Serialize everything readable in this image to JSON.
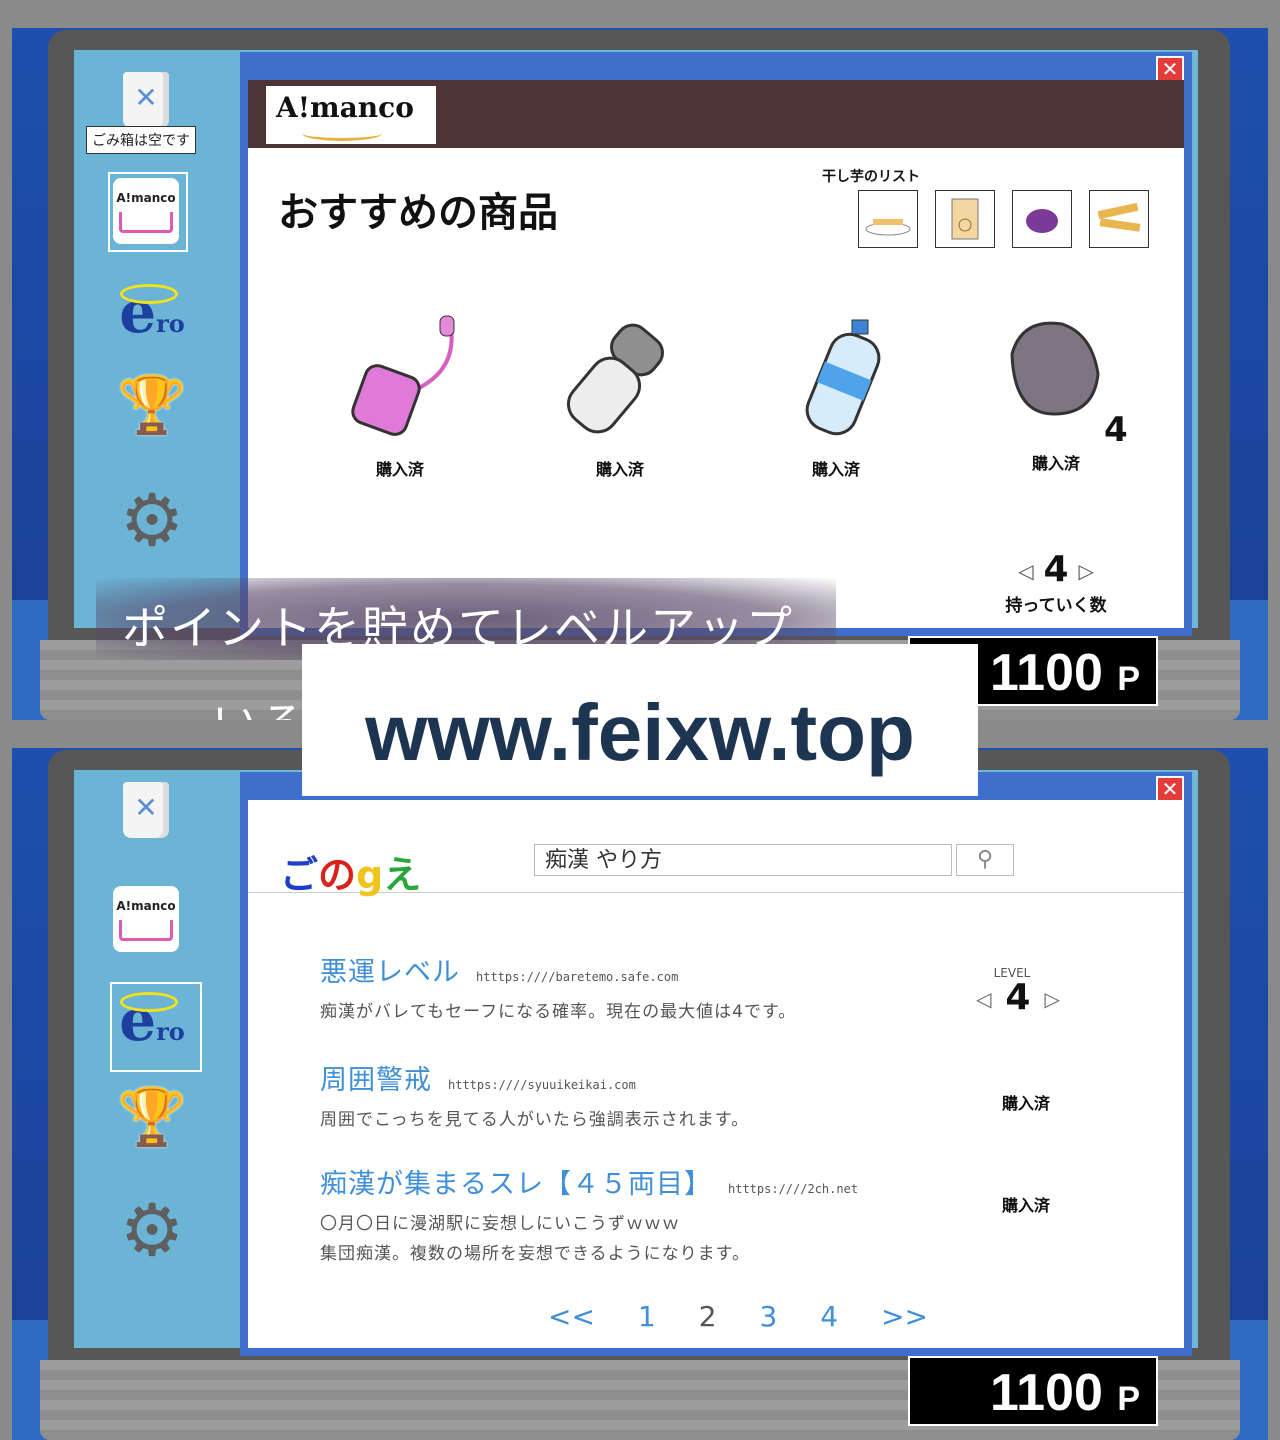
{
  "panel1": {
    "desktop": {
      "trash_tooltip": "ごみ箱は空です",
      "icons": [
        "trash-icon",
        "almanco-app-icon",
        "ero-browser-icon",
        "trophy-icon",
        "gear-icon"
      ],
      "almanco_icon_label": "A!manco",
      "ero_label_e": "e",
      "ero_label_ro": "ro"
    },
    "store": {
      "logo": "A!manco",
      "section_title": "おすすめの商品",
      "potato_list_title": "干し芋のリスト",
      "products": [
        {
          "name": "pink-vibrator",
          "status": "購入済"
        },
        {
          "name": "massager",
          "status": "購入済"
        },
        {
          "name": "water-bottle",
          "status": "購入済"
        },
        {
          "name": "stone",
          "status": "購入済",
          "count": "4"
        }
      ],
      "carry": {
        "value": "4",
        "prev": "◁",
        "next": "▷",
        "label": "持っていく数"
      }
    },
    "points": {
      "value": "1100",
      "unit": "P"
    },
    "caption_line1": "ポイントを貯めてレベルアップ",
    "caption_line2": "いろ",
    "watermark": "www.feixw.top",
    "close": "✕"
  },
  "panel2": {
    "desktop": {
      "almanco_icon_label": "A!manco",
      "ero_label_e": "e",
      "ero_label_ro": "ro"
    },
    "search": {
      "logo_letters": [
        "ご",
        "の",
        "g",
        "え"
      ],
      "logo_colors": [
        "#1f3fc8",
        "#d8231d",
        "#f0c51b",
        "#2aa63c"
      ],
      "query": "痴漢  やり方",
      "button_icon": "search-icon"
    },
    "results": [
      {
        "title": "悪運レベル",
        "url": "htttps:////baretemo.safe.com",
        "desc": [
          "痴漢がバレてもセーフになる確率。現在の最大値は4です。"
        ]
      },
      {
        "title": "周囲警戒",
        "url": "htttps:////syuuikeikai.com",
        "desc": [
          "周囲でこっちを見てる人がいたら強調表示されます。"
        ]
      },
      {
        "title": "痴漢が集まるスレ【４５両目】",
        "url": "htttps:////2ch.net",
        "desc": [
          "〇月〇日に漫湖駅に妄想しにいこうずｗｗｗ",
          "集団痴漢。複数の場所を妄想できるようになります。"
        ]
      }
    ],
    "level": {
      "label": "LEVEL",
      "value": "4",
      "prev": "◁",
      "next": "▷"
    },
    "bought": [
      "購入済",
      "購入済"
    ],
    "pager": [
      "<<",
      "1",
      "2",
      "3",
      "4",
      ">>"
    ],
    "points": {
      "value": "1100",
      "unit": "P"
    },
    "close": "✕"
  }
}
